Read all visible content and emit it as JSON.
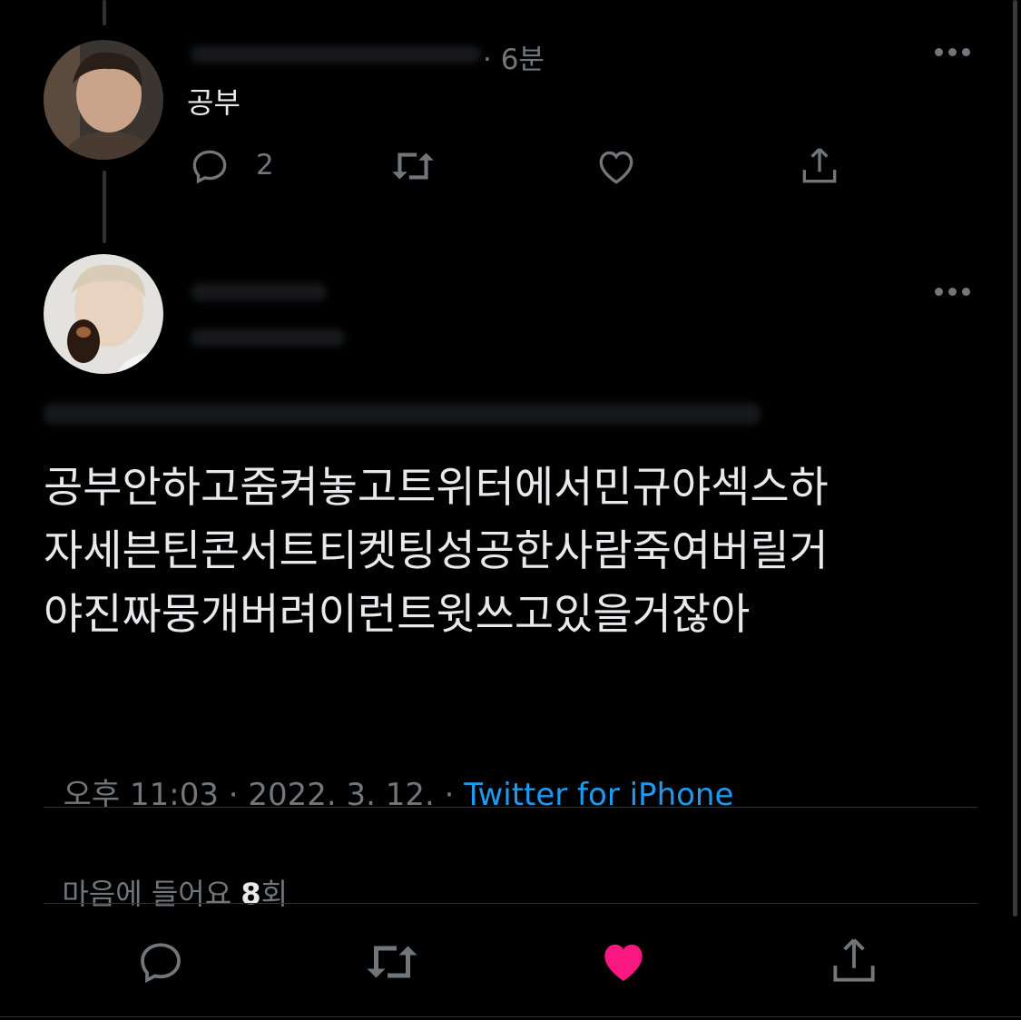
{
  "parent_tweet": {
    "time": "· 6분",
    "text": "공부",
    "reply_count": "2"
  },
  "main_tweet": {
    "text_lines": [
      "공부안하고줌켜놓고트위터에서민규야섹스하",
      "자세븐틴콘서트티켓팅성공한사람죽여버릴거",
      "야진짜뭉개버려이런트윗쓰고있을거잖아"
    ],
    "timestamp": "오후 11:03 · 2022. 3. 12. · ",
    "source": "Twitter for iPhone",
    "likes_prefix": "마음에 들어요 ",
    "likes_count": "8",
    "likes_suffix": "회"
  },
  "colors": {
    "background": "#000000",
    "text": "#e7e9ea",
    "secondary": "#71767b",
    "link": "#1d9bf0",
    "like_active": "#f91880"
  },
  "icons": [
    "more-icon",
    "reply-icon",
    "retweet-icon",
    "like-icon",
    "share-icon"
  ]
}
